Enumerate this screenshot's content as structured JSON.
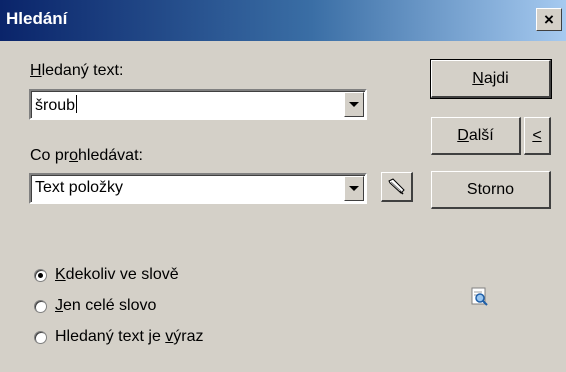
{
  "window": {
    "title": "Hledání",
    "close_label": "×"
  },
  "search": {
    "label_accel": "H",
    "label_rest": "ledaný text:",
    "value": "šroub"
  },
  "scope": {
    "label_pre": "Co pr",
    "label_accel": "o",
    "label_post": "hledávat:",
    "value": "Text položky"
  },
  "buttons": {
    "find_accel": "N",
    "find_rest": "ajdi",
    "next_accel": "D",
    "next_rest": "alší",
    "prev_label": "<",
    "cancel": "Storno"
  },
  "options": [
    {
      "accel": "K",
      "rest": "dekoliv ve slově",
      "checked": true
    },
    {
      "accel": "J",
      "rest": "en celé slovo",
      "checked": false
    },
    {
      "pre": "Hledaný text je ",
      "accel": "v",
      "rest": "ýraz",
      "checked": false
    }
  ],
  "colors": {
    "title_start": "#0a246a",
    "title_end": "#a6caf0",
    "face": "#d4d0c8"
  },
  "icons": [
    "close-icon",
    "dropdown-arrow-icon",
    "picker-icon",
    "find-icon"
  ]
}
